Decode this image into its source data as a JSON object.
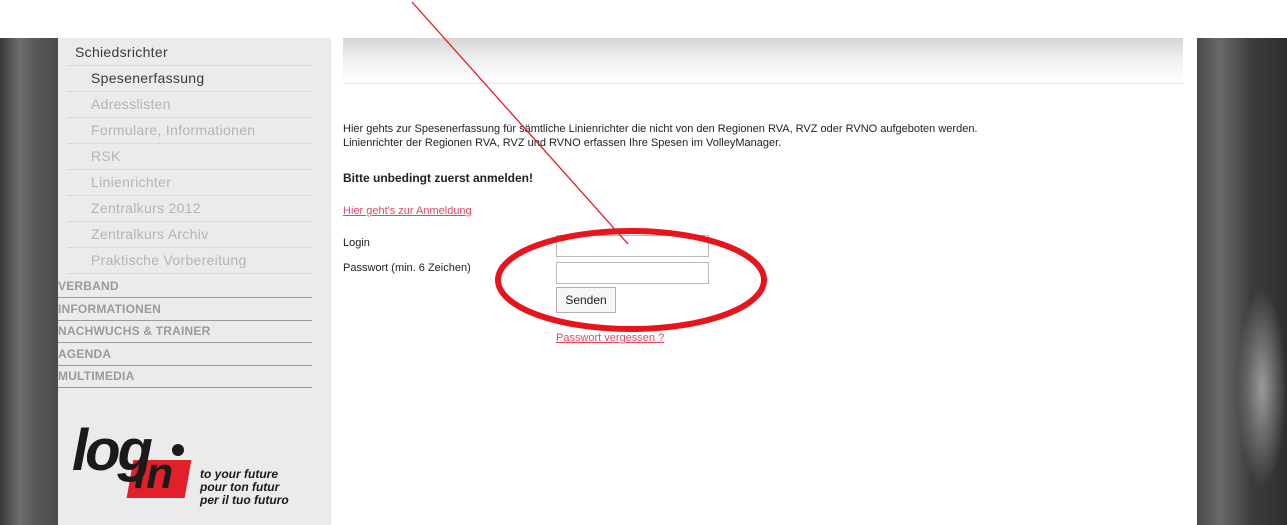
{
  "sidebar": {
    "items": [
      {
        "label": "Schiedsrichter",
        "level": "head"
      },
      {
        "label": "Spesenerfassung",
        "level": "sub",
        "selected": true
      },
      {
        "label": "Adresslisten",
        "level": "sub"
      },
      {
        "label": "Formulare, Informationen",
        "level": "sub"
      },
      {
        "label": "RSK",
        "level": "sub"
      },
      {
        "label": "Linienrichter",
        "level": "sub"
      },
      {
        "label": "Zentralkurs 2012",
        "level": "sub"
      },
      {
        "label": "Zentralkurs Archiv",
        "level": "sub"
      },
      {
        "label": "Praktische Vorbereitung",
        "level": "sub"
      }
    ],
    "sections": [
      "VERBAND",
      "INFORMATIONEN",
      "NACHWUCHS & TRAINER",
      "AGENDA",
      "MULTIMEDIA"
    ]
  },
  "logo": {
    "word_log": "log",
    "word_in": "in",
    "tagline": [
      "to your future",
      "pour ton futur",
      "per il tuo futuro"
    ],
    "accent_color": "#e2202a"
  },
  "main": {
    "intro_line1": "Hier gehts zur Spesenerfassung für sämtliche Linienrichter die nicht von den Regionen RVA, RVZ oder RVNO aufgeboten werden.",
    "intro_line2": "Linienrichter der Regionen RVA, RVZ und RVNO erfassen Ihre Spesen im VolleyManager.",
    "notice": "Bitte unbedingt zuerst anmelden!",
    "register_link": "Hier geht's zur Anmeldung",
    "login_label": "Login",
    "password_label": "Passwort (min. 6 Zeichen)",
    "login_value": "",
    "password_value": "",
    "submit_label": "Senden",
    "forgot_link": "Passwort vergessen ?"
  },
  "annotation": {
    "color": "#e8141c"
  }
}
